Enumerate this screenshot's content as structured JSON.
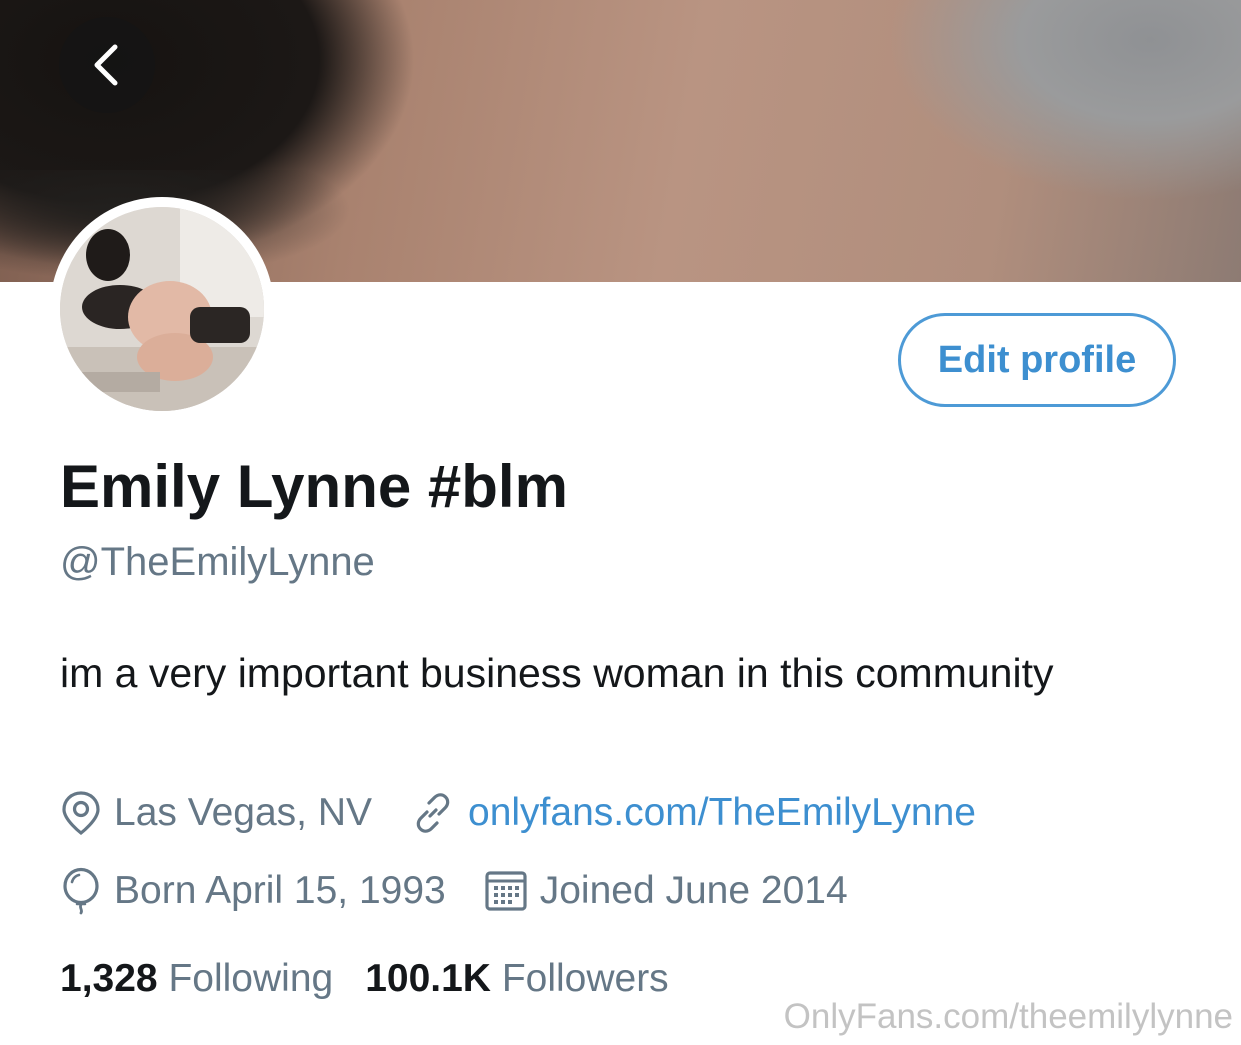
{
  "profile": {
    "display_name": "Emily Lynne #blm",
    "handle": "@TheEmilyLynne",
    "bio": "im a very important business woman in this community",
    "location": "Las Vegas, NV",
    "website": "onlyfans.com/TheEmilyLynne",
    "birthday": "Born April 15, 1993",
    "joined": "Joined June 2014"
  },
  "actions": {
    "edit_profile_label": "Edit profile"
  },
  "stats": {
    "following_count": "1,328",
    "following_label": "Following",
    "followers_count": "100.1K",
    "followers_label": "Followers"
  },
  "watermark": "OnlyFans.com/theemilylynne",
  "icons": {
    "back": "chevron-left-icon",
    "location": "location-pin-icon",
    "website": "link-icon",
    "birthday": "balloon-icon",
    "joined": "calendar-icon"
  },
  "colors": {
    "accent": "#3d8fd0",
    "primary_text": "#14171a",
    "secondary_text": "#657786"
  }
}
